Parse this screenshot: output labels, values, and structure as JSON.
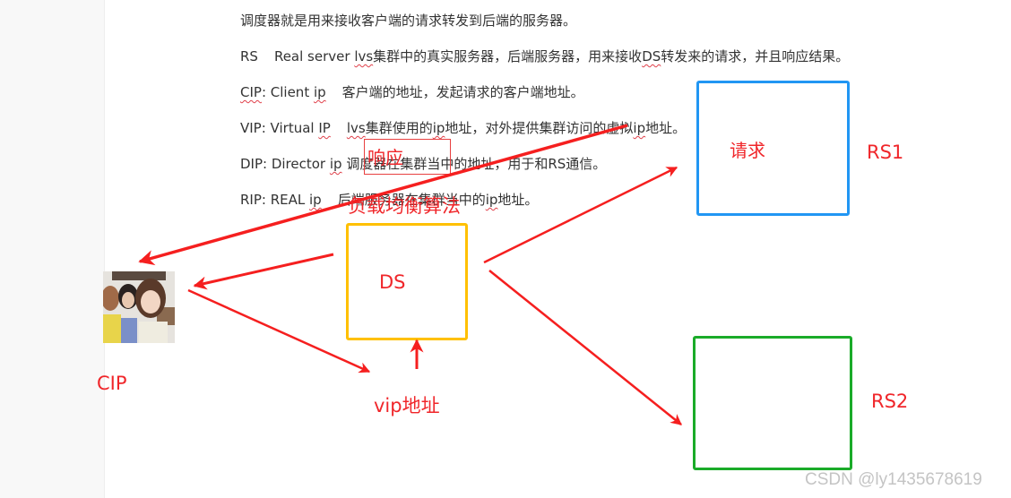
{
  "document": {
    "lines": [
      {
        "parts": [
          {
            "t": "调度器就是用来接收客户端的请求转发到后端的服务器。"
          }
        ]
      },
      {
        "parts": [
          {
            "t": "RS"
          },
          {
            "gap": true
          },
          {
            "t": "Real server "
          },
          {
            "t": "lvs",
            "sq": true
          },
          {
            "t": "集群中的真实服务器，后端服务器，用来接收"
          },
          {
            "t": "DS",
            "sq": true
          },
          {
            "t": "转发来的请求，并且响应结果。"
          }
        ]
      },
      {
        "parts": [
          {
            "t": "CIP",
            "sq": true
          },
          {
            "t": ":  Client "
          },
          {
            "t": "ip",
            "sq": true
          },
          {
            "gap": true
          },
          {
            "t": "客户端的地址，发起请求的客户端地址。"
          }
        ]
      },
      {
        "parts": [
          {
            "t": "VIP: Virtual "
          },
          {
            "t": "IP",
            "sq": true
          },
          {
            "gap": true
          },
          {
            "t": "lvs",
            "sq": true
          },
          {
            "t": "集群使用的"
          },
          {
            "t": "ip",
            "sq": true
          },
          {
            "t": "地址，对外提供集群访问的虚拟"
          },
          {
            "t": "ip",
            "sq": true
          },
          {
            "t": "地址。"
          }
        ]
      },
      {
        "parts": [
          {
            "t": "DIP:  Director "
          },
          {
            "t": "ip",
            "sq": true
          },
          {
            "t": "  调度器在集群当中的地址，用于和RS通信。"
          }
        ]
      },
      {
        "parts": [
          {
            "t": "RIP:  REAL "
          },
          {
            "t": "ip",
            "sq": true
          },
          {
            "gap": true
          },
          {
            "t": "后端服务器在集群当中的"
          },
          {
            "t": "ip",
            "sq": true
          },
          {
            "t": "地址。"
          }
        ]
      }
    ]
  },
  "diagram": {
    "nodes": {
      "client": {
        "label": "CIP",
        "image": "client-photo"
      },
      "director": {
        "label": "DS",
        "color": "#ffc000"
      },
      "rs1": {
        "label": "RS1",
        "inner_label": "请求",
        "color": "#2196f3"
      },
      "rs2": {
        "label": "RS2",
        "color": "#1aab29"
      }
    },
    "annotations": {
      "response": "响应",
      "load_balance": "负载均衡算法",
      "vip": "vip地址"
    },
    "arrow_color": "#f51f1f",
    "label_color": "#f0262a"
  },
  "watermark": "CSDN @ly1435678619"
}
